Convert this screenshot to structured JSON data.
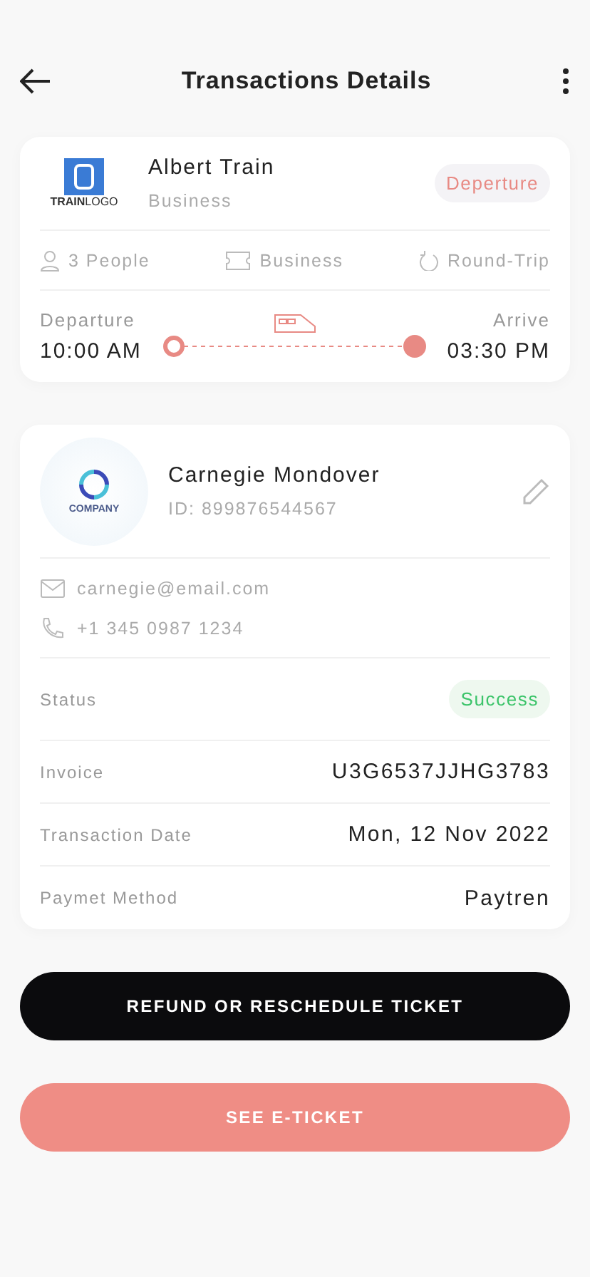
{
  "header": {
    "title": "Transactions Details"
  },
  "trip": {
    "logo_text": "**TRAIN**LOGO",
    "name": "Albert Train",
    "class": "Business",
    "badge": "Deperture",
    "features": [
      {
        "kind": "people",
        "label": "3 People"
      },
      {
        "kind": "ticket",
        "label": "Business"
      },
      {
        "kind": "round",
        "label": "Round-Trip"
      }
    ],
    "departure": {
      "label": "Departure",
      "time": "10:00 AM"
    },
    "arrive": {
      "label": "Arrive",
      "time": "03:30 PM"
    }
  },
  "customer": {
    "logo_text": "COMPANY",
    "name": "Carnegie Mondover",
    "id": "ID: 899876544567",
    "contacts": [
      {
        "kind": "email",
        "value": "carnegie@email.com"
      },
      {
        "kind": "phone",
        "value": "+1 345 0987 1234"
      }
    ],
    "details": [
      {
        "kind": "status",
        "label": "Status",
        "value": "Success"
      },
      {
        "kind": "text",
        "label": "Invoice",
        "value": "U3G6537JJHG3783"
      },
      {
        "kind": "text",
        "label": "Transaction Date",
        "value": "Mon, 12 Nov 2022"
      },
      {
        "kind": "text",
        "label": "Paymet Method",
        "value": "Paytren"
      }
    ]
  },
  "buttons": [
    {
      "kind": "dark",
      "label": "REFUND OR RESCHEDULE TICKET"
    },
    {
      "kind": "accent",
      "label": "SEE E-TICKET"
    }
  ]
}
